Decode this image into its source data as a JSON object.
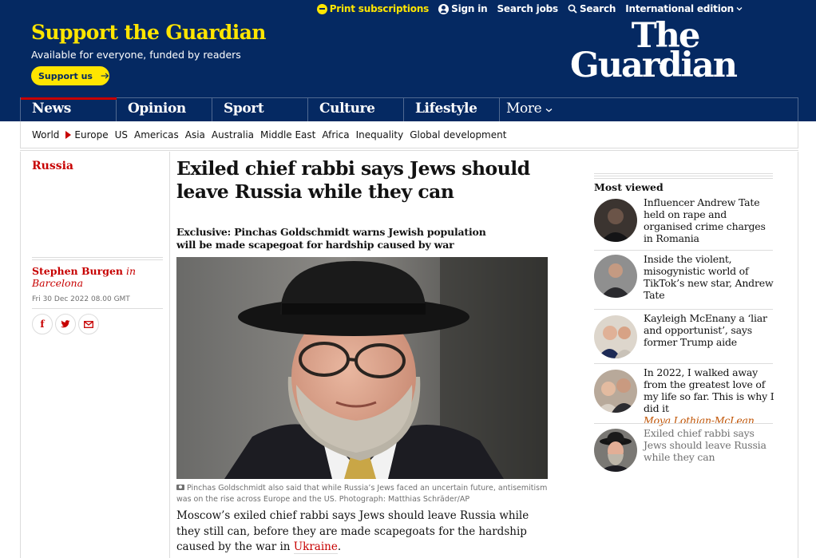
{
  "topbar": {
    "print_subscriptions": "Print subscriptions",
    "sign_in": "Sign in",
    "search_jobs": "Search jobs",
    "search": "Search",
    "edition": "International edition"
  },
  "masthead": {
    "support_title": "Support the Guardian",
    "support_subtitle": "Available for everyone, funded by readers",
    "support_button": "Support us",
    "logo_line1": "The",
    "logo_line2": "Guardian"
  },
  "nav": {
    "pillars": [
      "News",
      "Opinion",
      "Sport",
      "Culture",
      "Lifestyle"
    ],
    "more": "More",
    "active": "News"
  },
  "subnav": {
    "items": [
      "World",
      "Europe",
      "US",
      "Americas",
      "Asia",
      "Australia",
      "Middle East",
      "Africa",
      "Inequality",
      "Global development"
    ],
    "current": "Europe"
  },
  "article": {
    "section": "Russia",
    "headline": "Exiled chief rabbi says Jews should leave Russia while they can",
    "standfirst": "Exclusive: Pinchas Goldschmidt warns Jewish population will be made scapegoat for hardship caused by war",
    "author": "Stephen Burgen",
    "author_location_prefix": "in",
    "author_location": "Barcelona",
    "date": "Fri 30 Dec 2022 08.00 GMT",
    "caption": "Pinchas Goldschmidt also said that while Russia’s Jews faced an uncertain future, antisemitism was on the rise across Europe and the US. Photograph: Matthias Schräder/AP",
    "body_start": "Moscow’s exiled chief rabbi says Jews should leave Russia while they still can, before they are made scapegoats for the hardship caused by the war in ",
    "body_link": "Ukraine",
    "body_end": "."
  },
  "share": {
    "facebook": "f",
    "twitter": "t",
    "email": "✉"
  },
  "most_viewed": {
    "title": "Most viewed",
    "items": [
      {
        "text": "Influencer Andrew Tate held on rape and organised crime charges in Romania",
        "author": ""
      },
      {
        "text": "Inside the violent, misogynistic world of TikTok’s new star, Andrew Tate",
        "author": ""
      },
      {
        "text": "Kayleigh McEnany a ‘liar and opportunist’, says former Trump aide",
        "author": ""
      },
      {
        "text": "In 2022, I walked away from the greatest love of my life so far. This is why I did it",
        "author": "Moya Lothian-McLean"
      },
      {
        "text": "Exiled chief rabbi says Jews should leave Russia while they can",
        "author": ""
      }
    ]
  },
  "colors": {
    "brand": "#052962",
    "accent_yellow": "#ffe500",
    "news_red": "#c70000",
    "opinion_orange": "#c05303",
    "rule": "#dcdcdc"
  }
}
